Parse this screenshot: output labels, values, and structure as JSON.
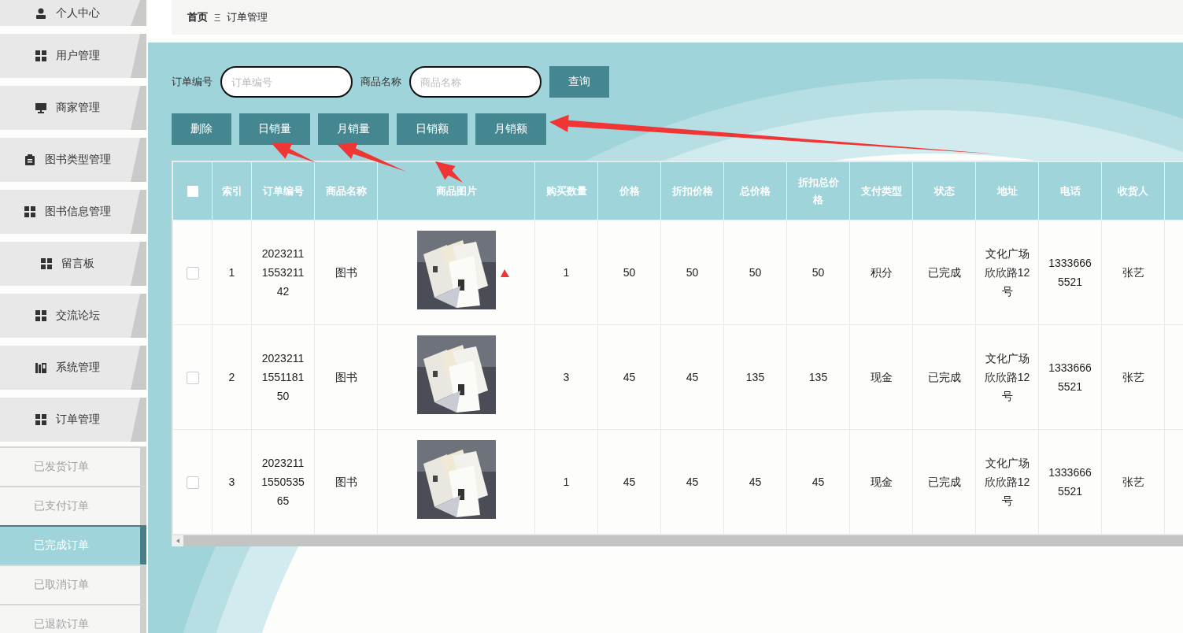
{
  "sidebar": {
    "items": [
      {
        "label": "个人中心",
        "selected": false
      },
      {
        "label": "用户管理",
        "selected": false
      },
      {
        "label": "商家管理",
        "selected": false
      },
      {
        "label": "图书类型管理",
        "selected": false
      },
      {
        "label": "图书信息管理",
        "selected": false
      },
      {
        "label": "留言板",
        "selected": false
      },
      {
        "label": "交流论坛",
        "selected": false
      },
      {
        "label": "系统管理",
        "selected": false
      },
      {
        "label": "订单管理",
        "selected": false
      }
    ],
    "sub_items": [
      {
        "label": "已发货订单",
        "selected": false
      },
      {
        "label": "已支付订单",
        "selected": false
      },
      {
        "label": "已完成订单",
        "selected": true
      },
      {
        "label": "已取消订单",
        "selected": false
      },
      {
        "label": "已退款订单",
        "selected": false
      }
    ]
  },
  "breadcrumb": {
    "home": "首页",
    "separator": "Ξ",
    "current": "订单管理"
  },
  "search": {
    "fields": [
      {
        "label": "订单编号",
        "placeholder": "订单编号"
      },
      {
        "label": "商品名称",
        "placeholder": "商品名称"
      }
    ],
    "button": "查询"
  },
  "actions": [
    "删除",
    "日销量",
    "月销量",
    "日销额",
    "月销额"
  ],
  "table": {
    "header_checkbox": {
      "checked": false
    },
    "columns": [
      "索引",
      "订单编号",
      "商品名称",
      "商品图片",
      "购买数量",
      "价格",
      "折扣价格",
      "总价格",
      "折扣总价格",
      "支付类型",
      "状态",
      "地址",
      "电话",
      "收货人"
    ],
    "rows": [
      {
        "checked": false,
        "cells": [
          "1",
          "2023211155321142",
          "图书",
          {
            "kind": "picture"
          },
          "1",
          "50",
          "50",
          "50",
          "50",
          "积分",
          "已完成",
          "文化广场欣欣路12号",
          "13336665521",
          "张艺"
        ]
      },
      {
        "checked": false,
        "cells": [
          "2",
          "2023211155118150",
          "图书",
          {
            "kind": "picture"
          },
          "3",
          "45",
          "45",
          "135",
          "135",
          "现金",
          "已完成",
          "文化广场欣欣路12号",
          "13336665521",
          "张艺"
        ]
      },
      {
        "checked": false,
        "cells": [
          "3",
          "2023211155053565",
          "图书",
          {
            "kind": "picture"
          },
          "1",
          "45",
          "45",
          "45",
          "45",
          "现金",
          "已完成",
          "文化广场欣欣路12号",
          "13336665521",
          "张艺"
        ]
      }
    ]
  }
}
